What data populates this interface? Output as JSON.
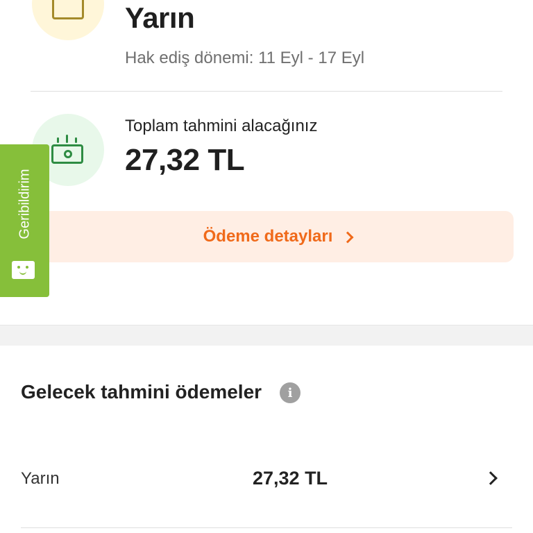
{
  "summary": {
    "title": "Yarın",
    "period": "Hak ediş dönemi: 11 Eyl - 17 Eyl",
    "total_label": "Toplam tahmini alacağınız",
    "total_value": "27,32 TL",
    "detail_button": "Ödeme detayları"
  },
  "feedback": {
    "label": "Geribildirim"
  },
  "future_payments": {
    "title": "Gelecek tahmini ödemeler",
    "info_glyph": "i",
    "rows": [
      {
        "label": "Yarın",
        "value": "27,32 TL"
      }
    ]
  },
  "colors": {
    "accent_orange": "#f06a1a",
    "feedback_green": "#86bf3a",
    "money_green": "#2e8c43",
    "calendar_gold": "#a48a2a"
  }
}
